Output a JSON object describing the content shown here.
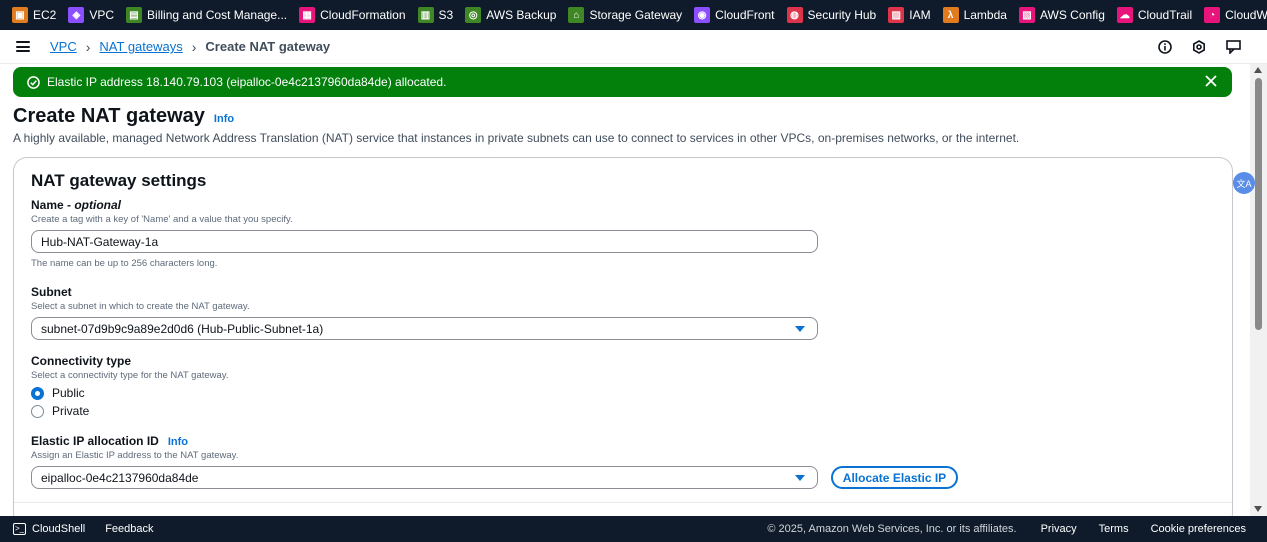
{
  "service_bar": {
    "items": [
      {
        "label": "EC2",
        "icon": "ec2-icon",
        "color": "#e07b20"
      },
      {
        "label": "VPC",
        "icon": "vpc-icon",
        "color": "#8c4fff"
      },
      {
        "label": "Billing and Cost Manage...",
        "icon": "billing-icon",
        "color": "#3f8624"
      },
      {
        "label": "CloudFormation",
        "icon": "cloudformation-icon",
        "color": "#e7157b"
      },
      {
        "label": "S3",
        "icon": "s3-icon",
        "color": "#3f8624"
      },
      {
        "label": "AWS Backup",
        "icon": "backup-icon",
        "color": "#3f8624"
      },
      {
        "label": "Storage Gateway",
        "icon": "storage-gateway-icon",
        "color": "#3f8624"
      },
      {
        "label": "CloudFront",
        "icon": "cloudfront-icon",
        "color": "#8c4fff"
      },
      {
        "label": "Security Hub",
        "icon": "security-hub-icon",
        "color": "#dd344c"
      },
      {
        "label": "IAM",
        "icon": "iam-icon",
        "color": "#dd344c"
      },
      {
        "label": "Lambda",
        "icon": "lambda-icon",
        "color": "#e07b20"
      },
      {
        "label": "AWS Config",
        "icon": "config-icon",
        "color": "#e7157b"
      },
      {
        "label": "CloudTrail",
        "icon": "cloudtrail-icon",
        "color": "#e7157b"
      },
      {
        "label": "CloudWatch",
        "icon": "cloudwatch-icon",
        "color": "#e7157b"
      }
    ]
  },
  "breadcrumb": {
    "items": [
      "VPC",
      "NAT gateways"
    ],
    "current": "Create NAT gateway"
  },
  "flash": {
    "message": "Elastic IP address 18.140.79.103 (eipalloc-0e4c2137960da84de) allocated.",
    "color": "#037f0c"
  },
  "page": {
    "title": "Create NAT gateway",
    "info": "Info",
    "description": "A highly available, managed Network Address Translation (NAT) service that instances in private subnets can use to connect to services in other VPCs, on-premises networks, or the internet."
  },
  "settings": {
    "heading": "NAT gateway settings",
    "name": {
      "label": "Name",
      "optional": " - optional",
      "description": "Create a tag with a key of 'Name' and a value that you specify.",
      "value": "Hub-NAT-Gateway-1a",
      "constraint": "The name can be up to 256 characters long."
    },
    "subnet": {
      "label": "Subnet",
      "description": "Select a subnet in which to create the NAT gateway.",
      "value": "subnet-07d9b9c9a89e2d0d6 (Hub-Public-Subnet-1a)"
    },
    "connectivity": {
      "label": "Connectivity type",
      "description": "Select a connectivity type for the NAT gateway.",
      "options": [
        "Public",
        "Private"
      ],
      "selected": "Public"
    },
    "eip": {
      "label": "Elastic IP allocation ID",
      "info": "Info",
      "description": "Assign an Elastic IP address to the NAT gateway.",
      "value": "eipalloc-0e4c2137960da84de",
      "button": "Allocate Elastic IP"
    }
  },
  "footer": {
    "cloudshell": "CloudShell",
    "feedback": "Feedback",
    "copyright": "© 2025, Amazon Web Services, Inc. or its affiliates.",
    "links": [
      "Privacy",
      "Terms",
      "Cookie preferences"
    ]
  },
  "colors": {
    "accent": "#0972d3",
    "nav_bg": "#0f1b2a"
  }
}
